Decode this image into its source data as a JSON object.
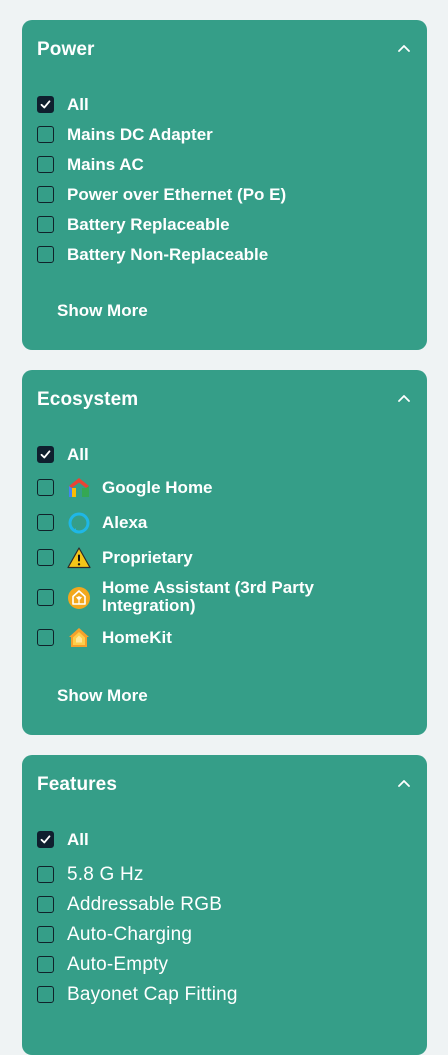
{
  "power": {
    "title": "Power",
    "options": [
      {
        "label": "All",
        "checked": true
      },
      {
        "label": "Mains DC Adapter",
        "checked": false
      },
      {
        "label": "Mains AC",
        "checked": false
      },
      {
        "label": "Power over Ethernet (Po E)",
        "checked": false
      },
      {
        "label": "Battery Replaceable",
        "checked": false
      },
      {
        "label": "Battery Non-Replaceable",
        "checked": false
      }
    ],
    "show_more": "Show More"
  },
  "ecosystem": {
    "title": "Ecosystem",
    "options": [
      {
        "label": "All",
        "checked": true
      },
      {
        "label": "Google Home",
        "checked": false,
        "icon": "google-home-icon"
      },
      {
        "label": "Alexa",
        "checked": false,
        "icon": "alexa-icon"
      },
      {
        "label": "Proprietary",
        "checked": false,
        "icon": "warning-icon"
      },
      {
        "label": "Home Assistant (3rd Party Integration)",
        "checked": false,
        "icon": "home-assistant-icon"
      },
      {
        "label": "HomeKit",
        "checked": false,
        "icon": "homekit-icon"
      }
    ],
    "show_more": "Show More"
  },
  "features": {
    "title": "Features",
    "options": [
      {
        "label": "All",
        "checked": true
      },
      {
        "label": "5.8 G Hz",
        "checked": false
      },
      {
        "label": "Addressable RGB",
        "checked": false
      },
      {
        "label": "Auto-Charging",
        "checked": false
      },
      {
        "label": "Auto-Empty",
        "checked": false
      },
      {
        "label": "Bayonet Cap Fitting",
        "checked": false
      }
    ]
  },
  "colors": {
    "panel_bg": "#359e88",
    "page_bg": "#eff3f4",
    "checkbox_checked": "#0f1f2e"
  }
}
